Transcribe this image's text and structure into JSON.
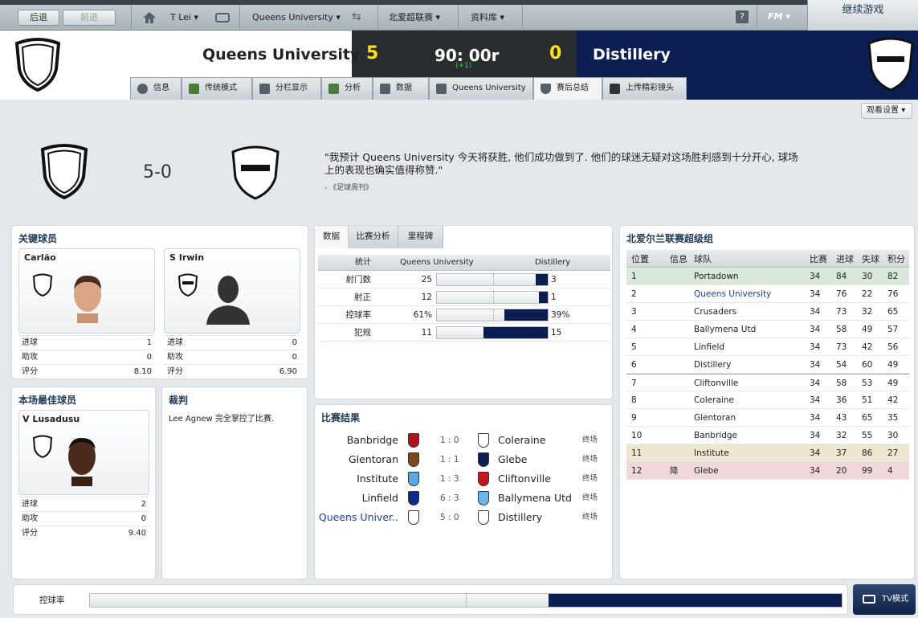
{
  "nav": {
    "back": "后退",
    "forward": "前进",
    "home_icon": "home-icon",
    "manager": "T Lei",
    "club": "Queens University",
    "league": "北爱超联赛",
    "database": "资料库",
    "help": "?",
    "fm_logo": "FM",
    "continue": "继续游戏"
  },
  "match": {
    "home": "Queens University",
    "away": "Distillery",
    "home_score": "5",
    "away_score": "0",
    "clock": "90: 00r",
    "added": "(+1)"
  },
  "tabs": [
    "信息",
    "传统模式",
    "分栏显示",
    "分析",
    "数据",
    "Queens University",
    "赛后总结",
    "上传精彩镜头"
  ],
  "view_settings": "观看设置",
  "summary": {
    "score": "5-0",
    "quote": "\"我预计 Queens University 今天将获胜, 他们成功做到了. 他们的球迷无疑对这场胜利感到十分开心, 球场上的表现也确实值得称赞.\"",
    "source": "- 《足球周刊》"
  },
  "key_players": {
    "title": "关键球员",
    "players": [
      {
        "name": "Carlão",
        "goals": "1",
        "assists": "0",
        "rating": "8.10"
      },
      {
        "name": "S Irwin",
        "goals": "0",
        "assists": "0",
        "rating": "6.90"
      }
    ]
  },
  "labels": {
    "goals": "进球",
    "assists": "助攻",
    "rating": "评分"
  },
  "best_player": {
    "title": "本场最佳球员",
    "name": "V Lusadusu",
    "goals": "2",
    "assists": "0",
    "rating": "9.40"
  },
  "referee": {
    "title": "裁判",
    "text": "Lee Agnew 完全掌控了比赛."
  },
  "stats_tabs": [
    "数据",
    "比赛分析",
    "里程碑"
  ],
  "stats": {
    "h_stat": "统计",
    "h_home": "Queens University",
    "h_away": "Distillery",
    "rows": [
      {
        "name": "射门数",
        "home": "25",
        "away": "3",
        "home_v": 25,
        "away_v": 3
      },
      {
        "name": "射正",
        "home": "12",
        "away": "1",
        "home_v": 12,
        "away_v": 1
      },
      {
        "name": "控球率",
        "home": "61%",
        "away": "39%",
        "home_v": 61,
        "away_v": 39
      },
      {
        "name": "犯规",
        "home": "11",
        "away": "15",
        "home_v": 11,
        "away_v": 15
      }
    ]
  },
  "results": {
    "title": "比赛结果",
    "rows": [
      {
        "home": "Banbridge",
        "score": "1 : 0",
        "away": "Coleraine",
        "status": "终场",
        "hc": "#b0141a",
        "ac": "#ffffff"
      },
      {
        "home": "Glentoran",
        "score": "1 : 1",
        "away": "Glebe",
        "status": "终场",
        "hc": "#7a4a1a",
        "ac": "#0b1e52"
      },
      {
        "home": "Institute",
        "score": "1 : 3",
        "away": "Cliftonville",
        "status": "终场",
        "hc": "#5aa8e0",
        "ac": "#c8141c"
      },
      {
        "home": "Linfield",
        "score": "6 : 3",
        "away": "Ballymena Utd",
        "status": "终场",
        "hc": "#0b2a8a",
        "ac": "#6ab8ea"
      },
      {
        "home": "Queens Univer..",
        "score": "5 : 0",
        "away": "Distillery",
        "status": "终场",
        "hc": "#ffffff",
        "ac": "#ffffff"
      }
    ]
  },
  "league": {
    "title": "北爱尔兰联赛超级组",
    "headers": [
      "位置",
      "信息",
      "球队",
      "比赛",
      "进球",
      "失球",
      "积分"
    ],
    "rows": [
      [
        "1",
        "",
        "Portadown",
        "34",
        "84",
        "30",
        "82"
      ],
      [
        "2",
        "",
        "Queens University",
        "34",
        "76",
        "22",
        "76"
      ],
      [
        "3",
        "",
        "Crusaders",
        "34",
        "73",
        "32",
        "65"
      ],
      [
        "4",
        "",
        "Ballymena Utd",
        "34",
        "58",
        "49",
        "57"
      ],
      [
        "5",
        "",
        "Linfield",
        "34",
        "73",
        "42",
        "56"
      ],
      [
        "6",
        "",
        "Distillery",
        "34",
        "54",
        "60",
        "49"
      ],
      [
        "7",
        "",
        "Cliftonville",
        "34",
        "58",
        "53",
        "49"
      ],
      [
        "8",
        "",
        "Coleraine",
        "34",
        "36",
        "51",
        "42"
      ],
      [
        "9",
        "",
        "Glentoran",
        "34",
        "43",
        "65",
        "35"
      ],
      [
        "10",
        "",
        "Banbridge",
        "34",
        "32",
        "55",
        "30"
      ],
      [
        "11",
        "",
        "Institute",
        "34",
        "37",
        "86",
        "27"
      ],
      [
        "12",
        "降",
        "Glebe",
        "34",
        "20",
        "99",
        "4"
      ]
    ]
  },
  "possession": {
    "label": "控球率",
    "home_pct": 61,
    "away_pct": 39
  },
  "tv_mode": "TV模式",
  "colors": {
    "navy": "#0b1e52",
    "score_yellow": "#ffe21a",
    "added_green": "#3ccf3c",
    "link_blue": "#1a3fa8"
  }
}
